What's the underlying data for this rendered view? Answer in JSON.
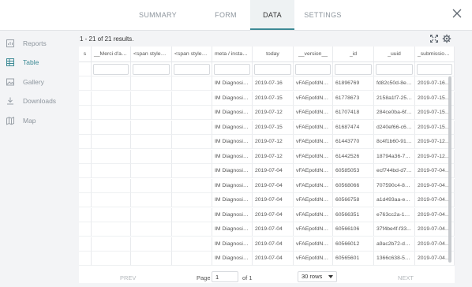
{
  "tabs": [
    {
      "label": "SUMMARY"
    },
    {
      "label": "FORM"
    },
    {
      "label": "DATA"
    },
    {
      "label": "SETTINGS"
    }
  ],
  "sidebar": {
    "items": [
      {
        "label": "Reports",
        "icon": "reports-icon"
      },
      {
        "label": "Table",
        "icon": "table-icon"
      },
      {
        "label": "Gallery",
        "icon": "gallery-icon"
      },
      {
        "label": "Downloads",
        "icon": "downloads-icon"
      },
      {
        "label": "Map",
        "icon": "map-icon"
      }
    ]
  },
  "results_text": "1 - 21 of 21 results.",
  "table": {
    "headers": [
      "s",
      "__Merci d'avoi...",
      "<span style=\"...",
      "<span style=\"...",
      "meta / instan...",
      "today",
      "__version__",
      "_id",
      "_uuid",
      "_submission_t..."
    ],
    "rows": [
      [
        "IM Diagnosis -...",
        "2019-07-16",
        "vFAEpofdNym...",
        "61896769",
        "fd82c50d-8ec...",
        "2019-07-16T1..."
      ],
      [
        "IM Diagnosis -...",
        "2019-07-15",
        "vFAEpofdNym...",
        "61778673",
        "2158a1f7-259...",
        "2019-07-15T1..."
      ],
      [
        "IM Diagnosis -...",
        "2019-07-12",
        "vFAEpofdNym...",
        "61707418",
        "284ce0ba-6f3...",
        "2019-07-15T1..."
      ],
      [
        "IM Diagnosis -...",
        "2019-07-15",
        "vFAEpofdNym...",
        "61687474",
        "d240ef66-c65...",
        "2019-07-15T0..."
      ],
      [
        "IM Diagnosis -...",
        "2019-07-12",
        "vFAEpofdNym...",
        "61443770",
        "8c4f1b60-91a...",
        "2019-07-12T1..."
      ],
      [
        "IM Diagnosis -...",
        "2019-07-12",
        "vFAEpofdNym...",
        "61442526",
        "18794a36-76...",
        "2019-07-12T1..."
      ],
      [
        "IM Diagnosis -...",
        "2019-07-04",
        "vFAEpofdNym...",
        "60585053",
        "ecf744bd-d72...",
        "2019-07-04T1..."
      ],
      [
        "IM Diagnosis -...",
        "2019-07-04",
        "vFAEpofdNym...",
        "60568066",
        "707590c4-8d...",
        "2019-07-04T1..."
      ],
      [
        "IM Diagnosis -...",
        "2019-07-04",
        "vFAEpofdNym...",
        "60566758",
        "a1d493aa-e7...",
        "2019-07-04T0..."
      ],
      [
        "IM Diagnosis -...",
        "2019-07-04",
        "vFAEpofdNym...",
        "60566351",
        "e763cc2a-1c2...",
        "2019-07-04T0..."
      ],
      [
        "IM Diagnosis -...",
        "2019-07-04",
        "vFAEpofdNym...",
        "60566106",
        "37f4be4f-f33...",
        "2019-07-04T0..."
      ],
      [
        "IM Diagnosis -...",
        "2019-07-04",
        "vFAEpofdNym...",
        "60566012",
        "a9ac2b72-d1...",
        "2019-07-04T0..."
      ],
      [
        "IM Diagnosis -...",
        "2019-07-04",
        "vFAEpofdNym...",
        "60565601",
        "1366c638-57...",
        "2019-07-04T0..."
      ]
    ]
  },
  "pagination": {
    "prev": "PREV",
    "next": "NEXT",
    "page_label": "Page",
    "page_value": "1",
    "of_text": "of 1",
    "rows_value": "30 rows"
  },
  "colors": {
    "accent": "#3d8a95"
  }
}
